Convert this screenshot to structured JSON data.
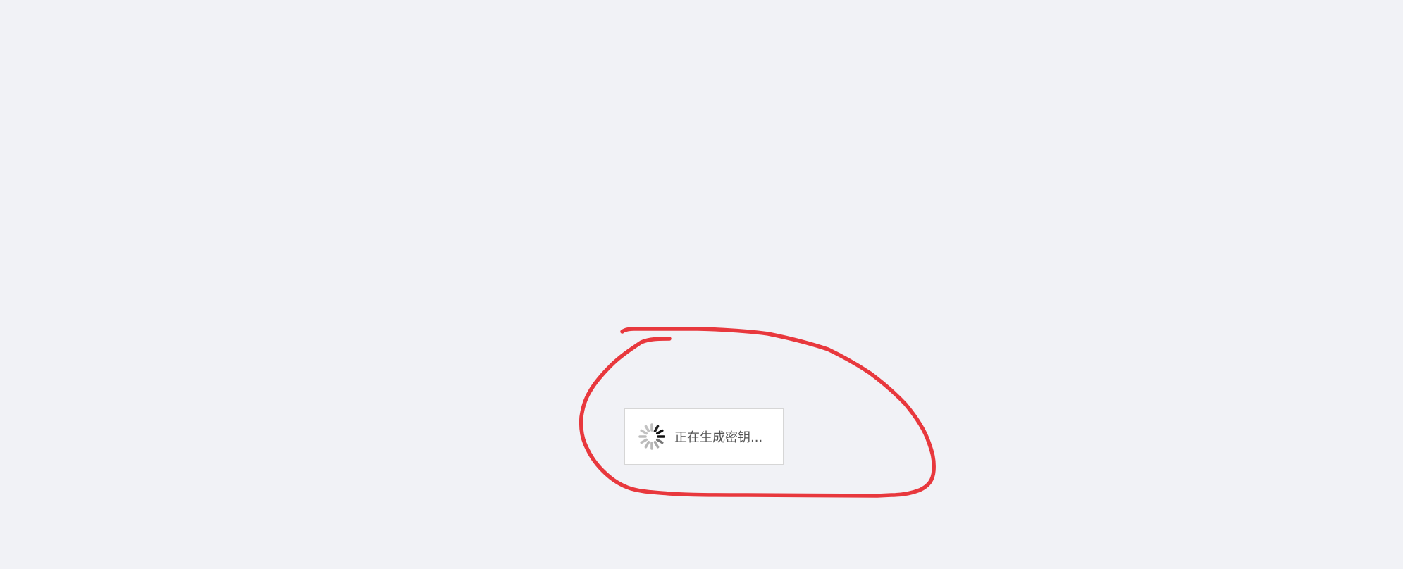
{
  "loading": {
    "message": "正在生成密钥...",
    "icon": "spinner-icon"
  },
  "annotation": {
    "color": "#e8383d"
  },
  "colors": {
    "background": "#f1f2f6",
    "box": "#ffffff",
    "text": "#555555"
  }
}
